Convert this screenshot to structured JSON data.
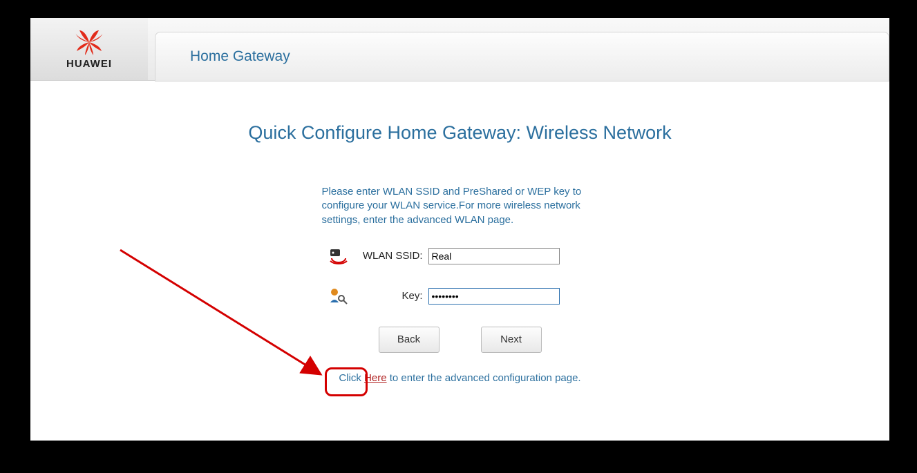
{
  "brand": {
    "name": "HUAWEI"
  },
  "header": {
    "tab_title": "Home Gateway"
  },
  "page": {
    "title": "Quick Configure Home Gateway: Wireless Network",
    "instructions": "Please enter WLAN SSID and PreShared or WEP key to configure your WLAN service.For more wireless network settings, enter the advanced WLAN page."
  },
  "form": {
    "ssid_label": "WLAN SSID:",
    "ssid_value": "Real",
    "key_label": "Key:",
    "key_value": "••••••••"
  },
  "buttons": {
    "back": "Back",
    "next": "Next"
  },
  "footer": {
    "prefix": "Click ",
    "link": "Here",
    "suffix": " to enter the advanced configuration page."
  }
}
